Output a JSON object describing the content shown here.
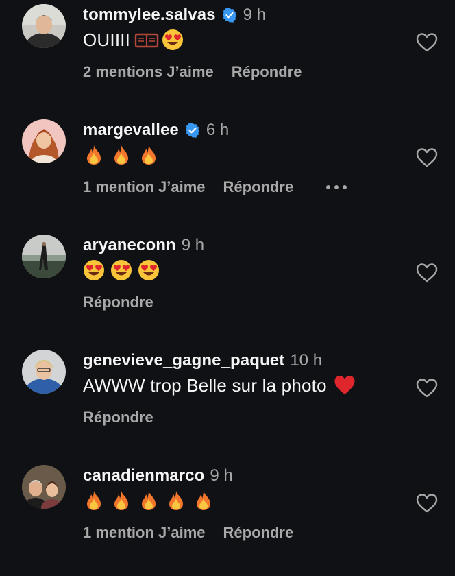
{
  "comments": [
    {
      "username": "tommylee.salvas",
      "verified": true,
      "time": "9 h",
      "text": "OUIIII",
      "text_emoji": [
        "book-icon",
        "heart-eyes-emoji"
      ],
      "likes": "2 mentions J’aime",
      "reply": "Répondre",
      "more": false
    },
    {
      "username": "margevallee",
      "verified": true,
      "time": "6 h",
      "text": "",
      "text_emoji": [
        "fire-emoji",
        "fire-emoji",
        "fire-emoji"
      ],
      "likes": "1 mention J’aime",
      "reply": "Répondre",
      "more": true
    },
    {
      "username": "aryaneconn",
      "verified": false,
      "time": "9 h",
      "text": "",
      "text_emoji": [
        "heart-eyes-emoji",
        "heart-eyes-emoji",
        "heart-eyes-emoji"
      ],
      "likes": "",
      "reply": "Répondre",
      "more": false
    },
    {
      "username": "genevieve_gagne_paquet",
      "verified": false,
      "time": "10 h",
      "text": "AWWW trop Belle sur la photo",
      "text_emoji": [
        "red-heart-emoji"
      ],
      "likes": "",
      "reply": "Répondre",
      "more": false
    },
    {
      "username": "canadienmarco",
      "verified": false,
      "time": "9 h",
      "text": "",
      "text_emoji": [
        "fire-emoji",
        "fire-emoji",
        "fire-emoji",
        "fire-emoji",
        "fire-emoji"
      ],
      "likes": "1 mention J’aime",
      "reply": "Répondre",
      "more": false
    }
  ],
  "colors": {
    "background": "#0f1114",
    "text": "#f5f5f5",
    "muted": "#a8a8a8",
    "verified": "#3897f0"
  }
}
